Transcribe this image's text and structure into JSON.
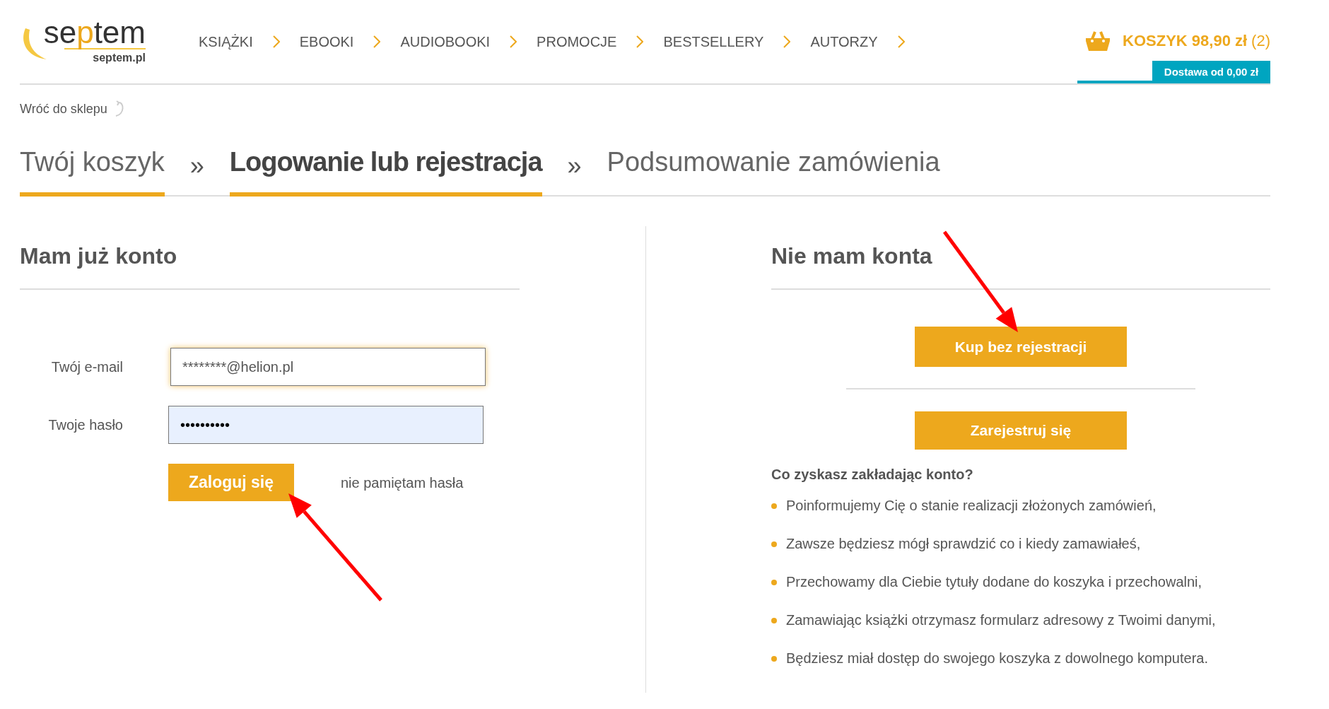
{
  "logo": {
    "parts": [
      {
        "text": "se",
        "highlight": false
      },
      {
        "text": "p",
        "highlight": true
      },
      {
        "text": "tem",
        "highlight": false
      }
    ],
    "domain": "septem.pl"
  },
  "nav": [
    "KSIĄŻKI",
    "EBOOKI",
    "AUDIOBOOKI",
    "PROMOCJE",
    "BESTSELLERY",
    "AUTORZY"
  ],
  "cart": {
    "label": "KOSZYK 98,90 zł",
    "count": "(2)",
    "delivery": "Dostawa od 0,00 zł"
  },
  "back_link": "Wróć do sklepu",
  "steps": [
    {
      "label": "Twój koszyk",
      "selected": false,
      "reached": true
    },
    {
      "label": "Logowanie lub rejestracja",
      "selected": true,
      "reached": true
    },
    {
      "label": "Podsumowanie zamówienia",
      "selected": false,
      "reached": false
    }
  ],
  "step_separator": "»",
  "login": {
    "title": "Mam już konto",
    "email_label": "Twój e-mail",
    "email_value": "********@helion.pl",
    "password_label": "Twoje hasło",
    "password_value": "••••••••••",
    "submit": "Zaloguj się",
    "forgot": "nie pamiętam hasła"
  },
  "register": {
    "title": "Nie mam konta",
    "guest_button": "Kup bez rejestracji",
    "register_button": "Zarejestruj się",
    "benefits_title": "Co zyskasz zakładając konto?",
    "benefits": [
      "Poinformujemy Cię o stanie realizacji złożonych zamówień,",
      "Zawsze będziesz mógł sprawdzić co i kiedy zamawiałeś,",
      "Przechowamy dla Ciebie tytuły dodane do koszyka i przechowalni,",
      "Zamawiając książki otrzymasz formularz adresowy z Twoimi danymi,",
      "Będziesz miał dostęp do swojego koszyka z dowolnego komputera."
    ]
  }
}
